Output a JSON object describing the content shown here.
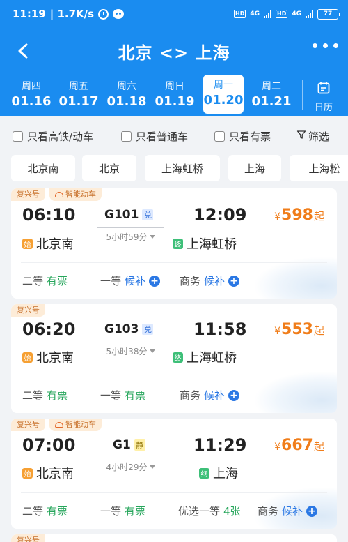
{
  "status_bar": {
    "time": "11:19",
    "speed": "| 1.7K/s",
    "net1": "4G",
    "net2": "4G",
    "battery": "77"
  },
  "nav": {
    "title": "北京 <> 上海"
  },
  "dates": [
    {
      "weekday": "周四",
      "date": "01.16"
    },
    {
      "weekday": "周五",
      "date": "01.17"
    },
    {
      "weekday": "周六",
      "date": "01.18"
    },
    {
      "weekday": "周日",
      "date": "01.19"
    },
    {
      "weekday": "周一",
      "date": "01.20",
      "active": true
    },
    {
      "weekday": "周二",
      "date": "01.21"
    }
  ],
  "calendar_label": "日历",
  "filters": {
    "high_speed": "只看高铁/动车",
    "normal": "只看普通车",
    "available": "只看有票",
    "filter": "筛选"
  },
  "station_chips": [
    "北京南",
    "北京",
    "上海虹桥",
    "上海",
    "上海松"
  ],
  "trains": [
    {
      "tags": [
        "复兴号",
        "智能动车"
      ],
      "dep_time": "06:10",
      "train_no": "G101",
      "badge": "兑",
      "duration": "5小时59分",
      "arr_time": "12:09",
      "from_badge": "始",
      "from": "北京南",
      "to_badge": "终",
      "to": "上海虹桥",
      "price_currency": "¥",
      "price": "598",
      "price_suffix": "起",
      "seats": [
        {
          "type": "二等",
          "status": "有票"
        },
        {
          "type": "一等",
          "status": "候补"
        },
        {
          "type": "商务",
          "status": "候补"
        }
      ]
    },
    {
      "tags": [
        "复兴号"
      ],
      "dep_time": "06:20",
      "train_no": "G103",
      "badge": "兑",
      "duration": "5小时38分",
      "arr_time": "11:58",
      "from_badge": "始",
      "from": "北京南",
      "to_badge": "终",
      "to": "上海虹桥",
      "price_currency": "¥",
      "price": "553",
      "price_suffix": "起",
      "seats": [
        {
          "type": "二等",
          "status": "有票"
        },
        {
          "type": "一等",
          "status": "有票"
        },
        {
          "type": "商务",
          "status": "候补"
        }
      ]
    },
    {
      "tags": [
        "复兴号",
        "智能动车"
      ],
      "dep_time": "07:00",
      "train_no": "G1",
      "badge": "静",
      "duration": "4小时29分",
      "arr_time": "11:29",
      "from_badge": "始",
      "from": "北京南",
      "to_badge": "终",
      "to": "上海",
      "price_currency": "¥",
      "price": "667",
      "price_suffix": "起",
      "seats": [
        {
          "type": "二等",
          "status": "有票"
        },
        {
          "type": "一等",
          "status": "有票"
        },
        {
          "type": "优选一等",
          "status": "4张"
        },
        {
          "type": "商务",
          "status": "候补"
        }
      ]
    },
    {
      "tags": [
        "复兴号"
      ]
    }
  ],
  "colors": {
    "header_blue": "#1a8cf0",
    "price_orange": "#f07d1a",
    "available_green": "#26a65b",
    "waitlist_blue": "#2b78e4"
  }
}
